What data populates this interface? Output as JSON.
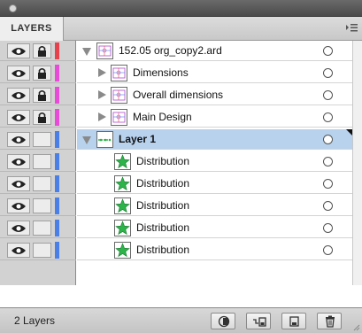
{
  "panel": {
    "tab_label": "LAYERS",
    "panel_menu_icon": "panel-menu-icon",
    "status_text": "2 Layers"
  },
  "layers": [
    {
      "name": "152.05 org_copy2.ard",
      "level": 0,
      "expanded": true,
      "color": "#e8414e",
      "bold": false,
      "selected": false,
      "lock": true
    },
    {
      "name": "Dimensions",
      "level": 1,
      "expanded": false,
      "color": "#e84bd8",
      "bold": false,
      "selected": false,
      "lock": true
    },
    {
      "name": "Overall dimensions",
      "level": 1,
      "expanded": false,
      "color": "#e84bd8",
      "bold": false,
      "selected": false,
      "lock": true
    },
    {
      "name": "Main Design",
      "level": 1,
      "expanded": false,
      "color": "#e84bd8",
      "bold": false,
      "selected": false,
      "lock": true
    },
    {
      "name": "Layer 1",
      "level": 0,
      "expanded": true,
      "color": "#4a7fe8",
      "bold": true,
      "selected": true,
      "lock": false
    },
    {
      "name": "Distribution",
      "level": 2,
      "expanded": null,
      "color": "#4a7fe8",
      "bold": false,
      "selected": false,
      "lock": false
    },
    {
      "name": "Distribution",
      "level": 2,
      "expanded": null,
      "color": "#4a7fe8",
      "bold": false,
      "selected": false,
      "lock": false
    },
    {
      "name": "Distribution",
      "level": 2,
      "expanded": null,
      "color": "#4a7fe8",
      "bold": false,
      "selected": false,
      "lock": false
    },
    {
      "name": "Distribution",
      "level": 2,
      "expanded": null,
      "color": "#4a7fe8",
      "bold": false,
      "selected": false,
      "lock": false
    },
    {
      "name": "Distribution",
      "level": 2,
      "expanded": null,
      "color": "#4a7fe8",
      "bold": false,
      "selected": false,
      "lock": false
    }
  ],
  "toolbar_buttons": [
    {
      "name": "make-clipping-mask-button",
      "icon": "clipping-mask-icon"
    },
    {
      "name": "create-sublayer-button",
      "icon": "new-sublayer-icon"
    },
    {
      "name": "create-layer-button",
      "icon": "new-layer-icon"
    },
    {
      "name": "delete-layer-button",
      "icon": "trash-icon"
    }
  ]
}
